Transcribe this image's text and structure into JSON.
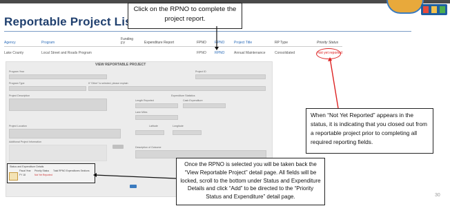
{
  "header": {
    "title": "Reportable Project List"
  },
  "colors": {
    "accent": "#1f3f6e",
    "link": "#2a6bb8",
    "alert": "#dd2222",
    "panel": "#ececec"
  },
  "callouts": {
    "rpno": "Click on the RPNO to complete the project report.",
    "not_reported": "When “Not Yet Reported” appears in the status, it is indicating that you closed out from a reportable project prior to completing all required reporting fields.",
    "view_page": "Once the RPNO is selected you will be taken back the “View Reportable Project” detail page. All fields will be locked, scroll to the bottom under Status and Expenditure Details and click “Add” to be directed to the “Priority Status and Expenditure” detail page."
  },
  "table": {
    "headers": [
      "Agency",
      "Program",
      "Funding FY",
      "Expenditure Report",
      "FPNO",
      "RPNO",
      "Project Title",
      "RP Type",
      "Priority Status"
    ],
    "row": [
      "Lake County",
      "Local Street and Roads Program",
      "",
      "",
      "FPNO",
      "RPNO",
      "Annual Maintenance",
      "Consolidated",
      "Not yet reported"
    ]
  },
  "detail": {
    "title": "VIEW REPORTABLE PROJECT",
    "fields": [
      "Program Year",
      "Project ID",
      "Program Type",
      "If \"Other\" is selected, please explain",
      "Project Description",
      "Expenditure Statistics",
      "Length Reported",
      "Cash Expenditure",
      "Lane Miles",
      "Total Expenditure",
      "Project Location",
      "Latitude",
      "Longitude",
      "Additional Project Information",
      "Description of Outcome"
    ],
    "status_box": {
      "title": "Status and Expenditure Details",
      "headers": [
        "Fiscal Year",
        "Priority Status",
        "Total RPNO Expenditures Sections"
      ],
      "values": [
        "FY 18",
        "Not Yet Reported"
      ]
    }
  },
  "page_number": "30",
  "icons": [
    "logo-seal-icon",
    "logo-people-icon"
  ]
}
